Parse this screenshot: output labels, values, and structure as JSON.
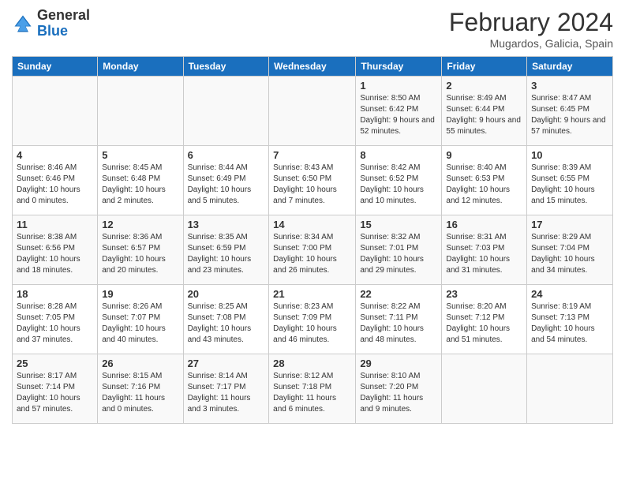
{
  "header": {
    "logo_general": "General",
    "logo_blue": "Blue",
    "month_title": "February 2024",
    "location": "Mugardos, Galicia, Spain"
  },
  "days_of_week": [
    "Sunday",
    "Monday",
    "Tuesday",
    "Wednesday",
    "Thursday",
    "Friday",
    "Saturday"
  ],
  "weeks": [
    [
      {
        "day": "",
        "info": ""
      },
      {
        "day": "",
        "info": ""
      },
      {
        "day": "",
        "info": ""
      },
      {
        "day": "",
        "info": ""
      },
      {
        "day": "1",
        "info": "Sunrise: 8:50 AM\nSunset: 6:42 PM\nDaylight: 9 hours and 52 minutes."
      },
      {
        "day": "2",
        "info": "Sunrise: 8:49 AM\nSunset: 6:44 PM\nDaylight: 9 hours and 55 minutes."
      },
      {
        "day": "3",
        "info": "Sunrise: 8:47 AM\nSunset: 6:45 PM\nDaylight: 9 hours and 57 minutes."
      }
    ],
    [
      {
        "day": "4",
        "info": "Sunrise: 8:46 AM\nSunset: 6:46 PM\nDaylight: 10 hours and 0 minutes."
      },
      {
        "day": "5",
        "info": "Sunrise: 8:45 AM\nSunset: 6:48 PM\nDaylight: 10 hours and 2 minutes."
      },
      {
        "day": "6",
        "info": "Sunrise: 8:44 AM\nSunset: 6:49 PM\nDaylight: 10 hours and 5 minutes."
      },
      {
        "day": "7",
        "info": "Sunrise: 8:43 AM\nSunset: 6:50 PM\nDaylight: 10 hours and 7 minutes."
      },
      {
        "day": "8",
        "info": "Sunrise: 8:42 AM\nSunset: 6:52 PM\nDaylight: 10 hours and 10 minutes."
      },
      {
        "day": "9",
        "info": "Sunrise: 8:40 AM\nSunset: 6:53 PM\nDaylight: 10 hours and 12 minutes."
      },
      {
        "day": "10",
        "info": "Sunrise: 8:39 AM\nSunset: 6:55 PM\nDaylight: 10 hours and 15 minutes."
      }
    ],
    [
      {
        "day": "11",
        "info": "Sunrise: 8:38 AM\nSunset: 6:56 PM\nDaylight: 10 hours and 18 minutes."
      },
      {
        "day": "12",
        "info": "Sunrise: 8:36 AM\nSunset: 6:57 PM\nDaylight: 10 hours and 20 minutes."
      },
      {
        "day": "13",
        "info": "Sunrise: 8:35 AM\nSunset: 6:59 PM\nDaylight: 10 hours and 23 minutes."
      },
      {
        "day": "14",
        "info": "Sunrise: 8:34 AM\nSunset: 7:00 PM\nDaylight: 10 hours and 26 minutes."
      },
      {
        "day": "15",
        "info": "Sunrise: 8:32 AM\nSunset: 7:01 PM\nDaylight: 10 hours and 29 minutes."
      },
      {
        "day": "16",
        "info": "Sunrise: 8:31 AM\nSunset: 7:03 PM\nDaylight: 10 hours and 31 minutes."
      },
      {
        "day": "17",
        "info": "Sunrise: 8:29 AM\nSunset: 7:04 PM\nDaylight: 10 hours and 34 minutes."
      }
    ],
    [
      {
        "day": "18",
        "info": "Sunrise: 8:28 AM\nSunset: 7:05 PM\nDaylight: 10 hours and 37 minutes."
      },
      {
        "day": "19",
        "info": "Sunrise: 8:26 AM\nSunset: 7:07 PM\nDaylight: 10 hours and 40 minutes."
      },
      {
        "day": "20",
        "info": "Sunrise: 8:25 AM\nSunset: 7:08 PM\nDaylight: 10 hours and 43 minutes."
      },
      {
        "day": "21",
        "info": "Sunrise: 8:23 AM\nSunset: 7:09 PM\nDaylight: 10 hours and 46 minutes."
      },
      {
        "day": "22",
        "info": "Sunrise: 8:22 AM\nSunset: 7:11 PM\nDaylight: 10 hours and 48 minutes."
      },
      {
        "day": "23",
        "info": "Sunrise: 8:20 AM\nSunset: 7:12 PM\nDaylight: 10 hours and 51 minutes."
      },
      {
        "day": "24",
        "info": "Sunrise: 8:19 AM\nSunset: 7:13 PM\nDaylight: 10 hours and 54 minutes."
      }
    ],
    [
      {
        "day": "25",
        "info": "Sunrise: 8:17 AM\nSunset: 7:14 PM\nDaylight: 10 hours and 57 minutes."
      },
      {
        "day": "26",
        "info": "Sunrise: 8:15 AM\nSunset: 7:16 PM\nDaylight: 11 hours and 0 minutes."
      },
      {
        "day": "27",
        "info": "Sunrise: 8:14 AM\nSunset: 7:17 PM\nDaylight: 11 hours and 3 minutes."
      },
      {
        "day": "28",
        "info": "Sunrise: 8:12 AM\nSunset: 7:18 PM\nDaylight: 11 hours and 6 minutes."
      },
      {
        "day": "29",
        "info": "Sunrise: 8:10 AM\nSunset: 7:20 PM\nDaylight: 11 hours and 9 minutes."
      },
      {
        "day": "",
        "info": ""
      },
      {
        "day": "",
        "info": ""
      }
    ]
  ]
}
